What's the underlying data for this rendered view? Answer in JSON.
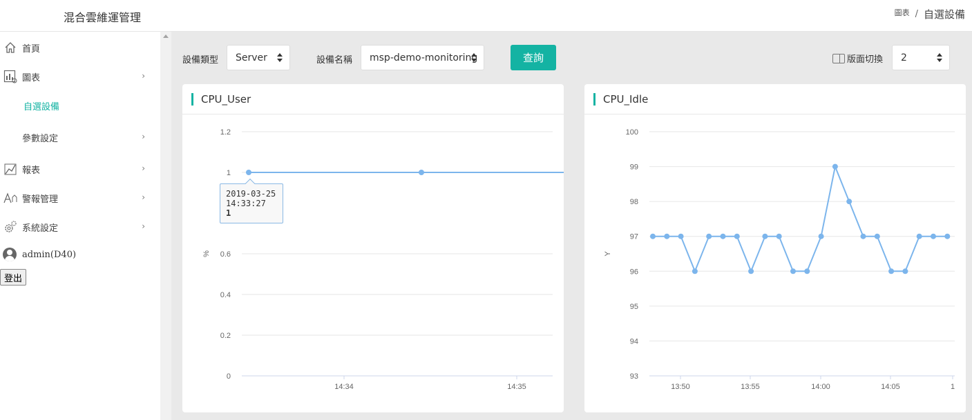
{
  "app": {
    "title": "混合雲維運管理"
  },
  "breadcrumb": {
    "parent": "圖表",
    "current": "自選設備"
  },
  "sidebar": {
    "items": [
      {
        "label": "首頁",
        "icon": "home-icon"
      },
      {
        "label": "圖表",
        "icon": "chart-icon"
      },
      {
        "label": "自選設備",
        "icon": ""
      },
      {
        "label": "參數設定",
        "icon": ""
      },
      {
        "label": "報表",
        "icon": "report-icon"
      },
      {
        "label": "警報管理",
        "icon": "alarm-icon"
      },
      {
        "label": "系統設定",
        "icon": "gear-icon"
      }
    ],
    "user": "admin(D40)",
    "logout": "登出"
  },
  "toolbar": {
    "device_type_label": "設備類型",
    "device_type_value": "Server",
    "device_name_label": "設備名稱",
    "device_name_value": "msp-demo-monitoring",
    "query_button": "查詢",
    "layout_toggle_label": "版面切換",
    "layout_value": "2"
  },
  "colors": {
    "accent": "#14b3a3",
    "series": "#7cb5ec"
  },
  "charts": {
    "cpu_user": {
      "title": "CPU_User"
    },
    "cpu_idle": {
      "title": "CPU_Idle"
    }
  },
  "tooltip": {
    "date": "2019-03-25",
    "time": "14:33:27",
    "value": "1"
  },
  "chart_data": [
    {
      "type": "line",
      "title": "CPU_User",
      "ylabel": "%",
      "ylim": [
        0,
        1.2
      ],
      "yticks": [
        0,
        0.2,
        0.4,
        0.6,
        1,
        1.2
      ],
      "ytick_labels": [
        "0",
        "0.2",
        "0.4",
        "0.6",
        "1",
        "1.2"
      ],
      "xtick_labels": [
        "14:34",
        "14:35"
      ],
      "series": [
        {
          "x": [
            "14:33:27",
            "14:34:27",
            "14:35:27"
          ],
          "values": [
            1,
            1,
            1
          ]
        }
      ]
    },
    {
      "type": "line",
      "title": "CPU_Idle",
      "ylabel": "Y",
      "ylim": [
        93,
        100
      ],
      "yticks": [
        93,
        94,
        95,
        96,
        97,
        98,
        99,
        100
      ],
      "ytick_labels": [
        "93",
        "94",
        "95",
        "96",
        "97",
        "98",
        "99",
        "100"
      ],
      "xtick_labels": [
        "13:50",
        "13:55",
        "14:00",
        "14:05",
        "1"
      ],
      "series": [
        {
          "values": [
            97,
            97,
            97,
            96,
            97,
            97,
            97,
            96,
            97,
            97,
            96,
            96,
            97,
            99,
            98,
            97,
            97,
            96,
            96,
            97,
            97,
            97
          ]
        }
      ]
    }
  ]
}
